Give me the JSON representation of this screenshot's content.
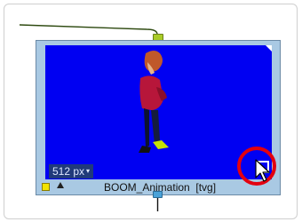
{
  "node": {
    "name": "BOOM_Animation",
    "type_suffix": "[tvg]",
    "resolution_label": "512 px",
    "resolution_caret": "▾"
  },
  "colors": {
    "thumbnail_bg": "#0000f2",
    "node_frame": "#a9c9e3",
    "input_port": "#a9cc27",
    "output_port": "#4aa2d8",
    "node_color_swatch": "#f2e300",
    "highlight_ring": "#e3000f"
  },
  "icons": {
    "input_port": "input-port-icon",
    "output_port": "output-port-icon",
    "color_swatch": "color-swatch-icon",
    "expand": "triangle-up-icon",
    "toggle": "square-outline-icon",
    "cursor": "arrow-cursor-icon"
  }
}
